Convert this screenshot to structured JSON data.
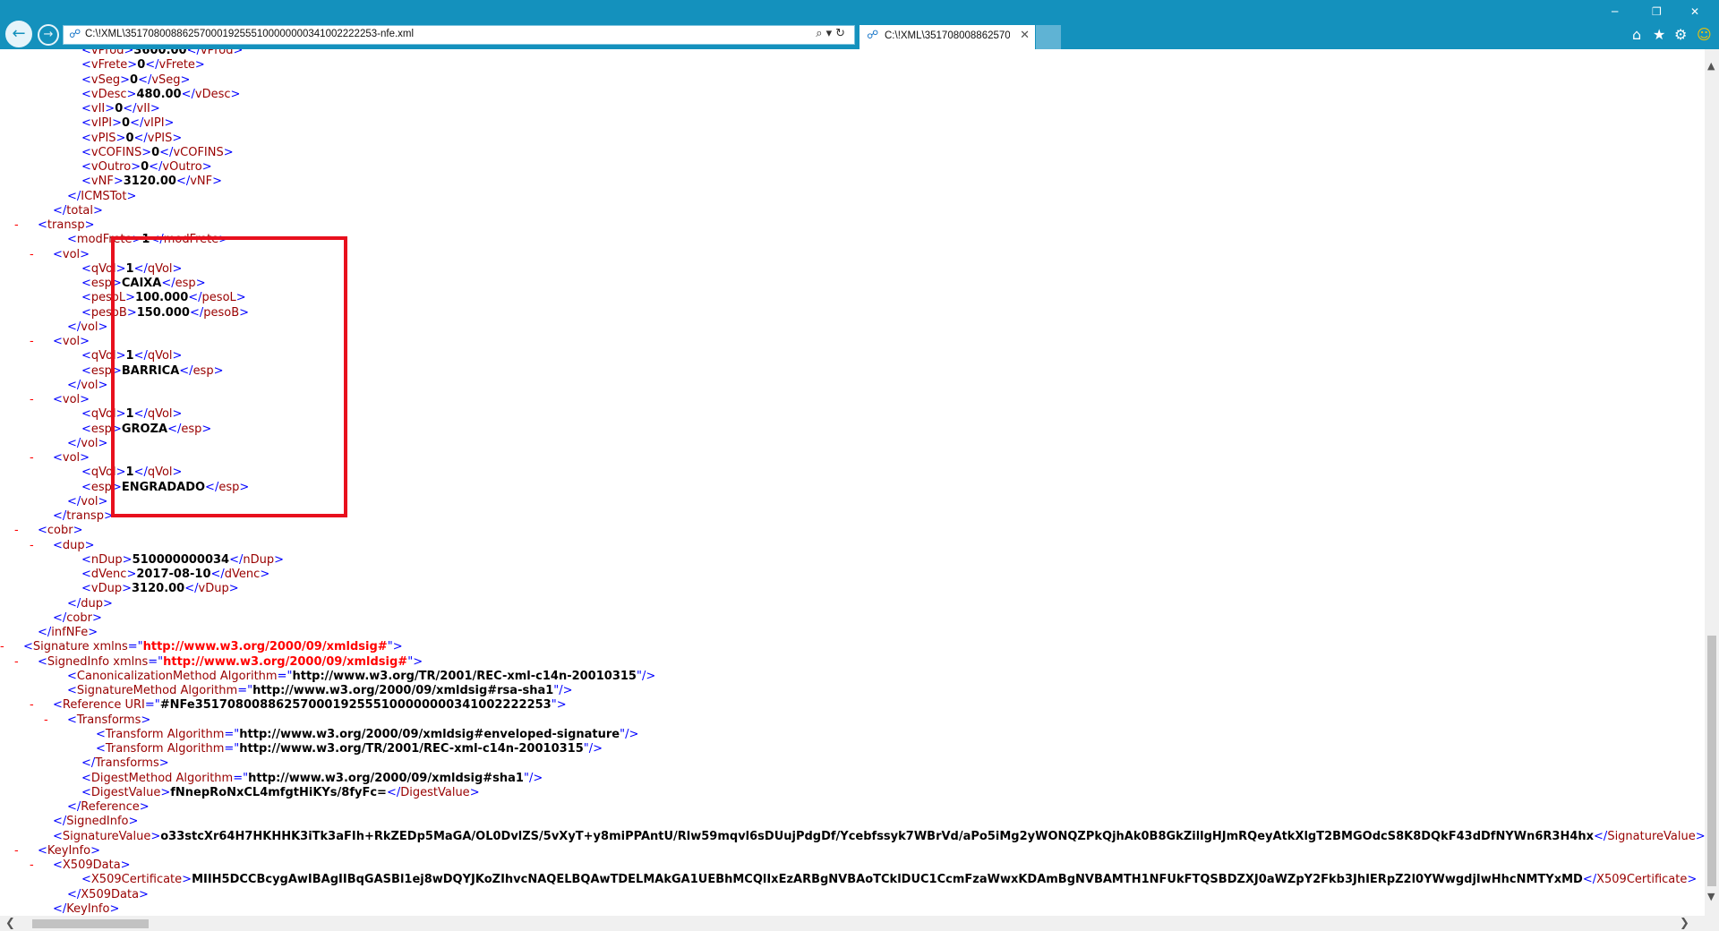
{
  "browser": {
    "url": "C:\\!XML\\35170800886257000192555100000000341002222253-nfe.xml",
    "tab_title": "C:\\!XML\\3517080088625700...",
    "icons": {
      "back": "back-arrow-icon",
      "forward": "forward-arrow-icon",
      "search": "search-icon",
      "dropdown": "chevron-down-icon",
      "refresh": "refresh-icon",
      "close_tab": "close-icon",
      "home": "home-icon",
      "favorites": "star-icon",
      "settings": "gear-icon",
      "feedback": "smiley-icon",
      "minimize": "minimize-icon",
      "restore": "restore-icon",
      "close": "close-icon"
    },
    "colors": {
      "chrome": "#1491bd",
      "highlight_box": "#e8101d"
    }
  },
  "xml_lines": [
    {
      "indent": 10,
      "t": "el",
      "name": "vProd",
      "value": "3600.00"
    },
    {
      "indent": 10,
      "t": "el",
      "name": "vFrete",
      "value": "0"
    },
    {
      "indent": 10,
      "t": "el",
      "name": "vSeg",
      "value": "0"
    },
    {
      "indent": 10,
      "t": "el",
      "name": "vDesc",
      "value": "480.00"
    },
    {
      "indent": 10,
      "t": "el",
      "name": "vII",
      "value": "0"
    },
    {
      "indent": 10,
      "t": "el",
      "name": "vIPI",
      "value": "0"
    },
    {
      "indent": 10,
      "t": "el",
      "name": "vPIS",
      "value": "0"
    },
    {
      "indent": 10,
      "t": "el",
      "name": "vCOFINS",
      "value": "0"
    },
    {
      "indent": 10,
      "t": "el",
      "name": "vOutro",
      "value": "0"
    },
    {
      "indent": 10,
      "t": "el",
      "name": "vNF",
      "value": "3120.00"
    },
    {
      "indent": 8,
      "t": "close",
      "name": "ICMSTot"
    },
    {
      "indent": 6,
      "t": "close",
      "name": "total"
    },
    {
      "indent": 4,
      "t": "open",
      "name": "transp",
      "minus": true
    },
    {
      "indent": 8,
      "t": "el",
      "name": "modFrete",
      "value": "1"
    },
    {
      "indent": 6,
      "t": "open",
      "name": "vol",
      "minus": true
    },
    {
      "indent": 10,
      "t": "el",
      "name": "qVol",
      "value": "1"
    },
    {
      "indent": 10,
      "t": "el",
      "name": "esp",
      "value": "CAIXA"
    },
    {
      "indent": 10,
      "t": "el",
      "name": "pesoL",
      "value": "100.000"
    },
    {
      "indent": 10,
      "t": "el",
      "name": "pesoB",
      "value": "150.000"
    },
    {
      "indent": 8,
      "t": "close",
      "name": "vol"
    },
    {
      "indent": 6,
      "t": "open",
      "name": "vol",
      "minus": true
    },
    {
      "indent": 10,
      "t": "el",
      "name": "qVol",
      "value": "1"
    },
    {
      "indent": 10,
      "t": "el",
      "name": "esp",
      "value": "BARRICA"
    },
    {
      "indent": 8,
      "t": "close",
      "name": "vol"
    },
    {
      "indent": 6,
      "t": "open",
      "name": "vol",
      "minus": true
    },
    {
      "indent": 10,
      "t": "el",
      "name": "qVol",
      "value": "1"
    },
    {
      "indent": 10,
      "t": "el",
      "name": "esp",
      "value": "GROZA"
    },
    {
      "indent": 8,
      "t": "close",
      "name": "vol"
    },
    {
      "indent": 6,
      "t": "open",
      "name": "vol",
      "minus": true
    },
    {
      "indent": 10,
      "t": "el",
      "name": "qVol",
      "value": "1"
    },
    {
      "indent": 10,
      "t": "el",
      "name": "esp",
      "value": "ENGRADADO"
    },
    {
      "indent": 8,
      "t": "close",
      "name": "vol"
    },
    {
      "indent": 6,
      "t": "close",
      "name": "transp"
    },
    {
      "indent": 4,
      "t": "open",
      "name": "cobr",
      "minus": true
    },
    {
      "indent": 6,
      "t": "open",
      "name": "dup",
      "minus": true
    },
    {
      "indent": 10,
      "t": "el",
      "name": "nDup",
      "value": "510000000034"
    },
    {
      "indent": 10,
      "t": "el",
      "name": "dVenc",
      "value": "2017-08-10"
    },
    {
      "indent": 10,
      "t": "el",
      "name": "vDup",
      "value": "3120.00"
    },
    {
      "indent": 8,
      "t": "close",
      "name": "dup"
    },
    {
      "indent": 6,
      "t": "close",
      "name": "cobr"
    },
    {
      "indent": 4,
      "t": "close",
      "name": "infNFe"
    },
    {
      "indent": 2,
      "t": "open",
      "name": "Signature",
      "minus": true,
      "attr": "xmlns",
      "attrval": "http://www.w3.org/2000/09/xmldsig#",
      "ns": true
    },
    {
      "indent": 4,
      "t": "open",
      "name": "SignedInfo",
      "minus": true,
      "attr": "xmlns",
      "attrval": "http://www.w3.org/2000/09/xmldsig#",
      "ns": true
    },
    {
      "indent": 8,
      "t": "self",
      "name": "CanonicalizationMethod",
      "attr": "Algorithm",
      "attrval": "http://www.w3.org/TR/2001/REC-xml-c14n-20010315"
    },
    {
      "indent": 8,
      "t": "self",
      "name": "SignatureMethod",
      "attr": "Algorithm",
      "attrval": "http://www.w3.org/2000/09/xmldsig#rsa-sha1"
    },
    {
      "indent": 6,
      "t": "open",
      "name": "Reference",
      "minus": true,
      "attr": "URI",
      "attrval": "#NFe35170800886257000192555100000000341002222253"
    },
    {
      "indent": 8,
      "t": "open",
      "name": "Transforms",
      "minus": true
    },
    {
      "indent": 12,
      "t": "self",
      "name": "Transform",
      "attr": "Algorithm",
      "attrval": "http://www.w3.org/2000/09/xmldsig#enveloped-signature"
    },
    {
      "indent": 12,
      "t": "self",
      "name": "Transform",
      "attr": "Algorithm",
      "attrval": "http://www.w3.org/TR/2001/REC-xml-c14n-20010315"
    },
    {
      "indent": 10,
      "t": "close",
      "name": "Transforms"
    },
    {
      "indent": 10,
      "t": "self",
      "name": "DigestMethod",
      "attr": "Algorithm",
      "attrval": "http://www.w3.org/2000/09/xmldsig#sha1"
    },
    {
      "indent": 10,
      "t": "el",
      "name": "DigestValue",
      "value": "fNnepRoNxCL4mfgtHiKYs/8fyFc="
    },
    {
      "indent": 8,
      "t": "close",
      "name": "Reference"
    },
    {
      "indent": 6,
      "t": "close",
      "name": "SignedInfo"
    },
    {
      "indent": 6,
      "t": "el",
      "name": "SignatureValue",
      "value": "o33stcXr64H7HKHHK3iTk3aFIh+RkZEDp5MaGA/OL0DvlZS/5vXyT+y8miPPAntU/Rlw59mqvl6sDUujPdgDf/Ycebfssyk7WBrVd/aPo5iMg2yWONQZPkQjhAk0B8GkZillgHJmRQeyAtkXlgT2BMGOdcS8K8DQkF43dDfNYWn6R3H4hx"
    },
    {
      "indent": 4,
      "t": "open",
      "name": "KeyInfo",
      "minus": true
    },
    {
      "indent": 6,
      "t": "open",
      "name": "X509Data",
      "minus": true
    },
    {
      "indent": 10,
      "t": "el",
      "name": "X509Certificate",
      "value": "MIIH5DCCBcygAwIBAgIIBqGASBl1ej8wDQYJKoZIhvcNAQELBQAwTDELMAkGA1UEBhMCQlIxEzARBgNVBAoTCklDUC1CcmFzaWwxKDAmBgNVBAMTH1NFUkFTQSBDZXJ0aWZpY2Fkb3JhIERpZ2l0YWwgdjIwHhcNMTYxMD"
    },
    {
      "indent": 8,
      "t": "close",
      "name": "X509Data"
    },
    {
      "indent": 6,
      "t": "close",
      "name": "KeyInfo"
    }
  ]
}
